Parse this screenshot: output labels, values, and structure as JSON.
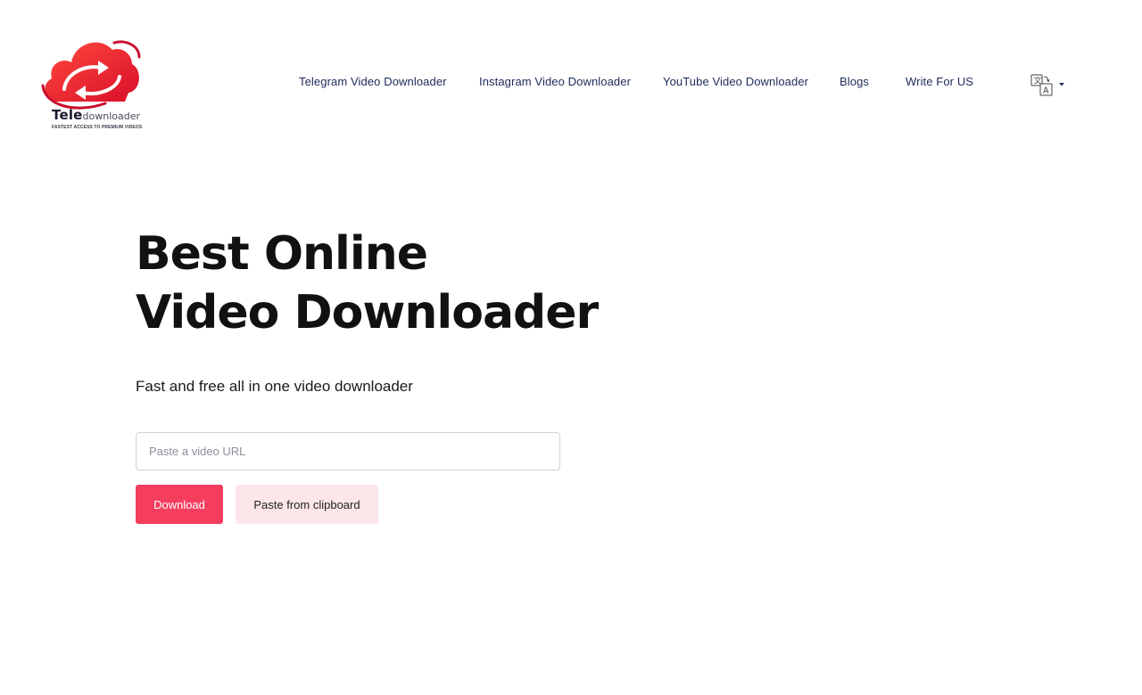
{
  "header": {
    "logo": {
      "word_bold": "Tele",
      "word_light": "downloader",
      "tagline": "FASTEST ACCESS TO PREMIUM VIDEOS",
      "icon": "cloud-arrows-icon"
    },
    "nav": [
      {
        "label": "Telegram Video Downloader"
      },
      {
        "label": "Instagram Video Downloader"
      },
      {
        "label": "YouTube Video Downloader"
      },
      {
        "label": "Blogs"
      },
      {
        "label": "Write For US"
      }
    ],
    "language_selector": {
      "icon": "translate-icon",
      "caret": "caret-down-icon"
    }
  },
  "hero": {
    "title_line1": "Best Online",
    "title_line2": "Video Downloader",
    "subtitle": "Fast and free all in one video downloader",
    "url_input": {
      "placeholder": "Paste a video URL",
      "value": ""
    },
    "download_label": "Download",
    "paste_label": "Paste from clipboard"
  },
  "colors": {
    "accent": "#f53d5e",
    "accent_light": "#fde6e9",
    "nav_text": "#1e2a5a",
    "logo_red": "#e8262f"
  }
}
